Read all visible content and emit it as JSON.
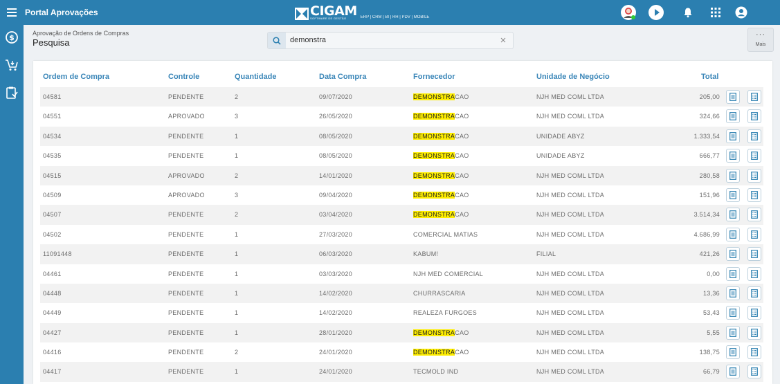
{
  "app": {
    "title": "Portal Aprovações",
    "logo_text": "CIGAM",
    "logo_subtext": "SOFTWARE DE GESTÃO",
    "logo_modules": "ERP | CRM | BI | RH | PDV | MOBILE"
  },
  "header": {
    "breadcrumb": "Aprovação de Ordens de Compras",
    "title": "Pesquisa",
    "search_value": "demonstra",
    "more_label": "Mais"
  },
  "columns": [
    "Ordem de Compra",
    "Controle",
    "Quantidade",
    "Data Compra",
    "Fornecedor",
    "Unidade de Negócio",
    "Total"
  ],
  "rows": [
    {
      "ordem": "04581",
      "controle": "PENDENTE",
      "quantidade": "2",
      "data": "09/07/2020",
      "forn_hl": "DEMONSTRA",
      "forn_rest": "CAO",
      "unidade": "NJH MED COML LTDA",
      "total": "205,00"
    },
    {
      "ordem": "04551",
      "controle": "APROVADO",
      "quantidade": "3",
      "data": "26/05/2020",
      "forn_hl": "DEMONSTRA",
      "forn_rest": "CAO",
      "unidade": "NJH MED COML LTDA",
      "total": "324,66"
    },
    {
      "ordem": "04534",
      "controle": "PENDENTE",
      "quantidade": "1",
      "data": "08/05/2020",
      "forn_hl": "DEMONSTRA",
      "forn_rest": "CAO",
      "unidade": "UNIDADE ABYZ",
      "total": "1.333,54"
    },
    {
      "ordem": "04535",
      "controle": "PENDENTE",
      "quantidade": "1",
      "data": "08/05/2020",
      "forn_hl": "DEMONSTRA",
      "forn_rest": "CAO",
      "unidade": "UNIDADE ABYZ",
      "total": "666,77"
    },
    {
      "ordem": "04515",
      "controle": "APROVADO",
      "quantidade": "2",
      "data": "14/01/2020",
      "forn_hl": "DEMONSTRA",
      "forn_rest": "CAO",
      "unidade": "NJH MED COML LTDA",
      "total": "280,58"
    },
    {
      "ordem": "04509",
      "controle": "APROVADO",
      "quantidade": "3",
      "data": "09/04/2020",
      "forn_hl": "DEMONSTRA",
      "forn_rest": "CAO",
      "unidade": "NJH MED COML LTDA",
      "total": "151,96"
    },
    {
      "ordem": "04507",
      "controle": "PENDENTE",
      "quantidade": "2",
      "data": "03/04/2020",
      "forn_hl": "DEMONSTRA",
      "forn_rest": "CAO",
      "unidade": "NJH MED COML LTDA",
      "total": "3.514,34"
    },
    {
      "ordem": "04502",
      "controle": "PENDENTE",
      "quantidade": "1",
      "data": "27/03/2020",
      "forn_hl": "",
      "forn_rest": "COMERCIAL MATIAS",
      "unidade": "NJH MED COML LTDA",
      "total": "4.686,99"
    },
    {
      "ordem": "11091448",
      "controle": "PENDENTE",
      "quantidade": "1",
      "data": "06/03/2020",
      "forn_hl": "",
      "forn_rest": "KABUM!",
      "unidade": "FILIAL",
      "total": "421,26"
    },
    {
      "ordem": "04461",
      "controle": "PENDENTE",
      "quantidade": "1",
      "data": "03/03/2020",
      "forn_hl": "",
      "forn_rest": "NJH MED COMERCIAL",
      "unidade": "NJH MED COML LTDA",
      "total": "0,00"
    },
    {
      "ordem": "04448",
      "controle": "PENDENTE",
      "quantidade": "1",
      "data": "14/02/2020",
      "forn_hl": "",
      "forn_rest": "CHURRASCARIA",
      "unidade": "NJH MED COML LTDA",
      "total": "13,36"
    },
    {
      "ordem": "04449",
      "controle": "PENDENTE",
      "quantidade": "1",
      "data": "14/02/2020",
      "forn_hl": "",
      "forn_rest": "REALEZA FURGOES",
      "unidade": "NJH MED COML LTDA",
      "total": "53,43"
    },
    {
      "ordem": "04427",
      "controle": "PENDENTE",
      "quantidade": "1",
      "data": "28/01/2020",
      "forn_hl": "DEMONSTRA",
      "forn_rest": "CAO",
      "unidade": "NJH MED COML LTDA",
      "total": "5,55"
    },
    {
      "ordem": "04416",
      "controle": "PENDENTE",
      "quantidade": "2",
      "data": "24/01/2020",
      "forn_hl": "DEMONSTRA",
      "forn_rest": "CAO",
      "unidade": "NJH MED COML LTDA",
      "total": "138,75"
    },
    {
      "ordem": "04417",
      "controle": "PENDENTE",
      "quantidade": "1",
      "data": "24/01/2020",
      "forn_hl": "",
      "forn_rest": "TECMOLD IND",
      "unidade": "NJH MED COML LTDA",
      "total": "66,79"
    }
  ],
  "icons": {
    "menu": "menu-icon",
    "sidebar": [
      "dollar-icon",
      "cart-icon",
      "clipboard-icon"
    ],
    "top": [
      "user-avatar-icon",
      "play-icon",
      "bell-icon",
      "apps-grid-icon",
      "account-icon"
    ],
    "row_actions": [
      "document-icon",
      "checklist-icon"
    ]
  },
  "colors": {
    "primary": "#2b7fb0",
    "header_text": "#3a86b8",
    "highlight": "#ffee00",
    "row_alt": "#f2f2f2"
  }
}
